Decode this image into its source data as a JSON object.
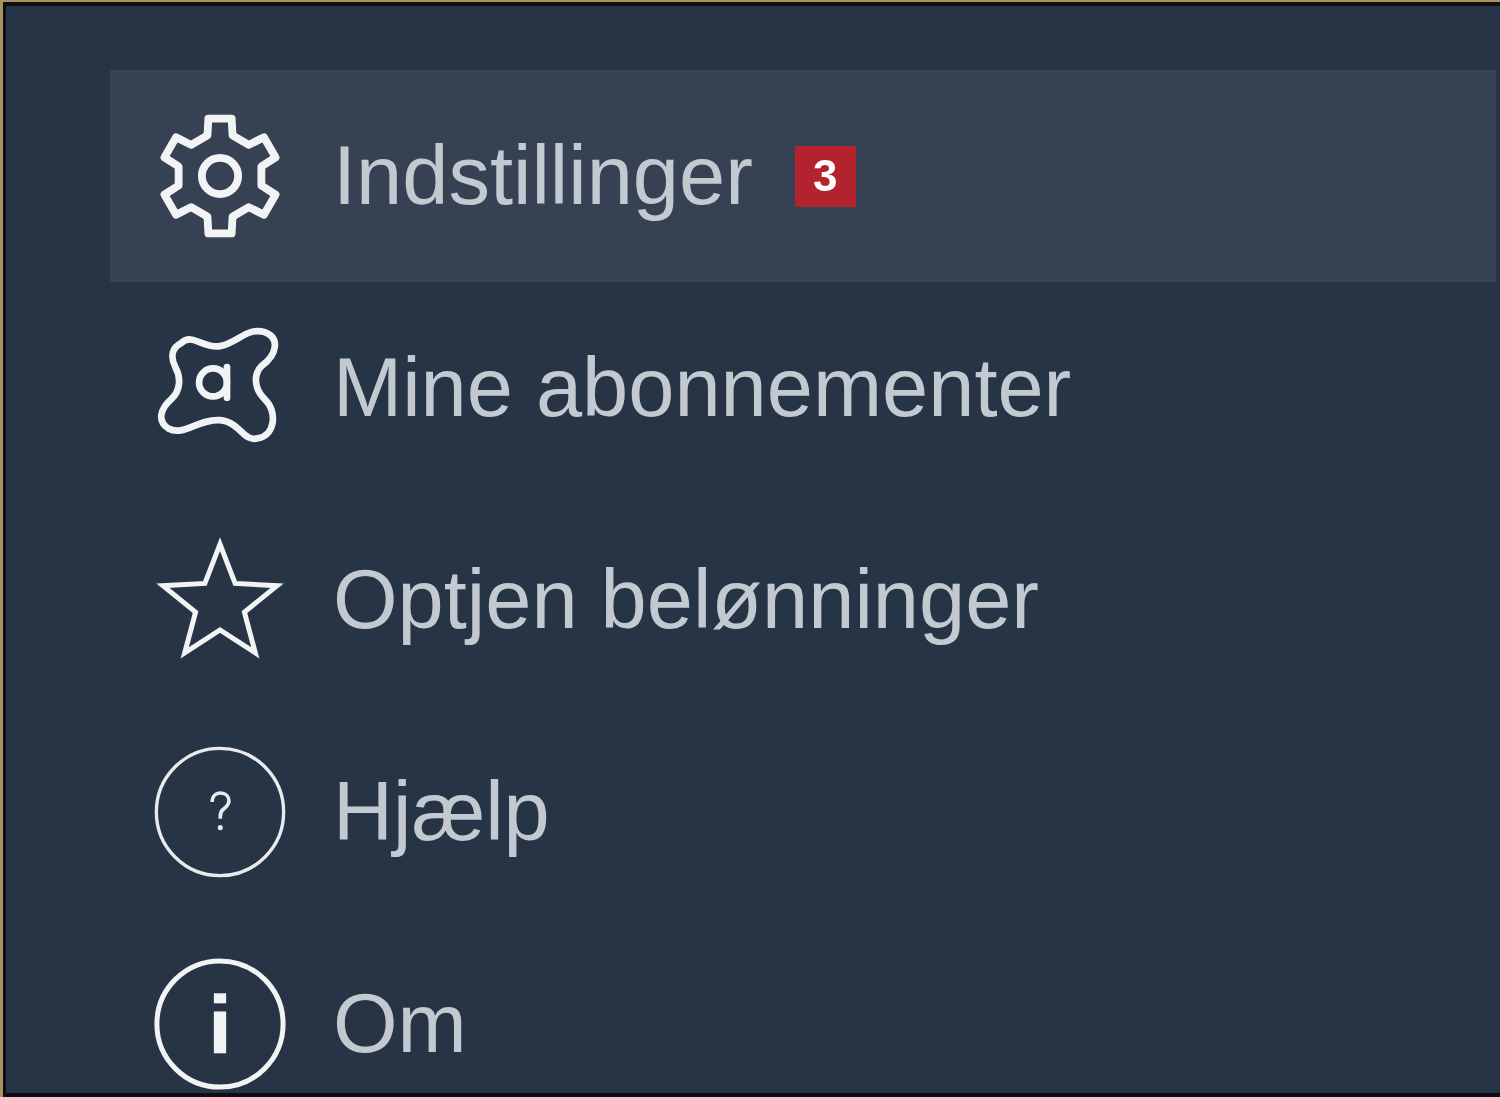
{
  "menu": {
    "items": [
      {
        "kind": "settings",
        "label": "Indstillinger",
        "selected": true,
        "badge": "3"
      },
      {
        "kind": "subscriptions",
        "label": "Mine abonnementer",
        "selected": false
      },
      {
        "kind": "rewards",
        "label": "Optjen belønninger",
        "selected": false
      },
      {
        "kind": "help",
        "label": "Hjælp",
        "selected": false
      },
      {
        "kind": "about",
        "label": "Om",
        "selected": false
      }
    ]
  }
}
